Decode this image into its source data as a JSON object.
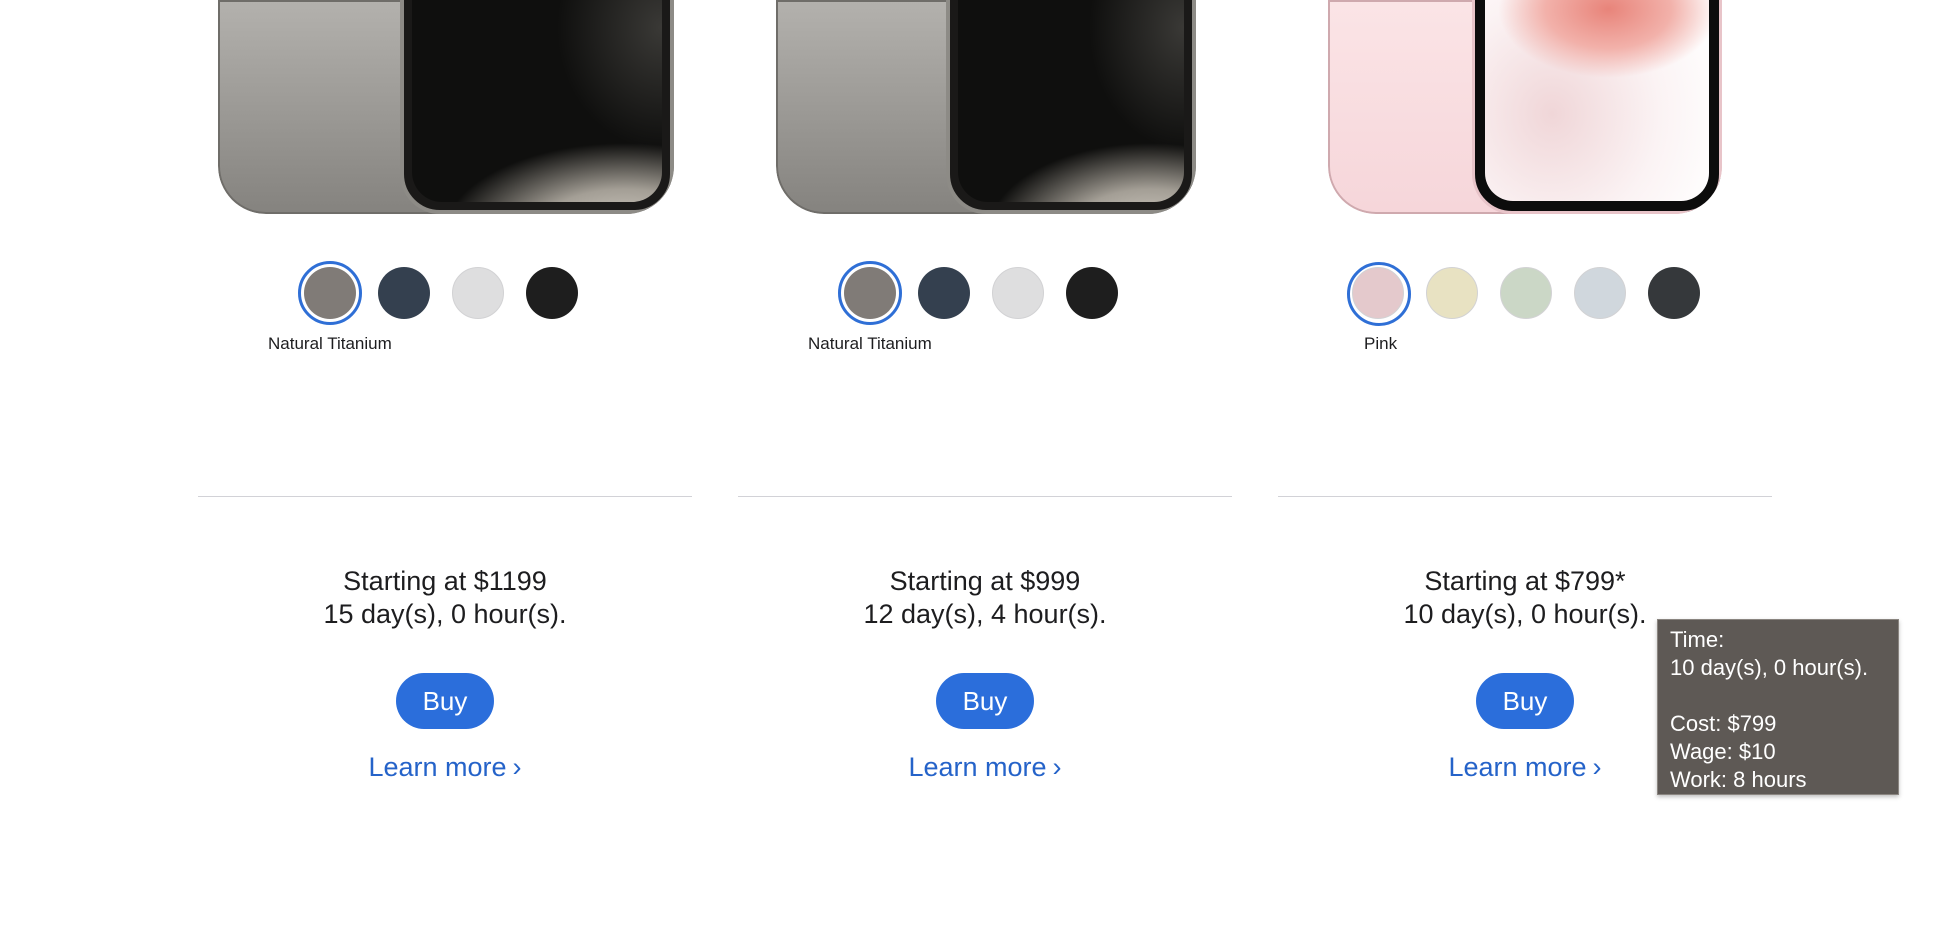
{
  "products": [
    {
      "color_name": "Natural Titanium",
      "swatches": [
        {
          "name": "natural-titanium",
          "color": "#807b77",
          "selected": true
        },
        {
          "name": "blue-titanium",
          "color": "#34404f",
          "selected": false
        },
        {
          "name": "white-titanium",
          "color": "#dededf",
          "selected": false
        },
        {
          "name": "black-titanium",
          "color": "#1e1e1e",
          "selected": false
        }
      ],
      "price": "Starting at $1199",
      "time": "15 day(s), 0 hour(s).",
      "buy_label": "Buy",
      "learn_more_label": "Learn more",
      "chevron": "›"
    },
    {
      "color_name": "Natural Titanium",
      "swatches": [
        {
          "name": "natural-titanium",
          "color": "#807b77",
          "selected": true
        },
        {
          "name": "blue-titanium",
          "color": "#34404f",
          "selected": false
        },
        {
          "name": "white-titanium",
          "color": "#dededf",
          "selected": false
        },
        {
          "name": "black-titanium",
          "color": "#1e1e1e",
          "selected": false
        }
      ],
      "price": "Starting at $999",
      "time": "12 day(s), 4 hour(s).",
      "buy_label": "Buy",
      "learn_more_label": "Learn more",
      "chevron": "›"
    },
    {
      "color_name": "Pink",
      "swatches": [
        {
          "name": "pink",
          "color": "#e4c9cc",
          "selected": true
        },
        {
          "name": "yellow",
          "color": "#e8e2c2",
          "selected": false
        },
        {
          "name": "green",
          "color": "#cbd7c6",
          "selected": false
        },
        {
          "name": "blue",
          "color": "#d0d7dd",
          "selected": false
        },
        {
          "name": "black",
          "color": "#35383b",
          "selected": false
        }
      ],
      "price": "Starting at $799*",
      "time": "10 day(s), 0 hour(s).",
      "buy_label": "Buy",
      "learn_more_label": "Learn more",
      "chevron": "›"
    }
  ],
  "tooltip": {
    "time_label": "Time:",
    "time_value": "10 day(s), 0 hour(s).",
    "cost": "Cost: $799",
    "wage": "Wage: $10",
    "work": "Work: 8 hours"
  },
  "colors": {
    "accent": "#2b6edb",
    "link": "#2563c9",
    "selected_ring": "#2f6fd6",
    "tooltip_bg": "#5e5955"
  }
}
